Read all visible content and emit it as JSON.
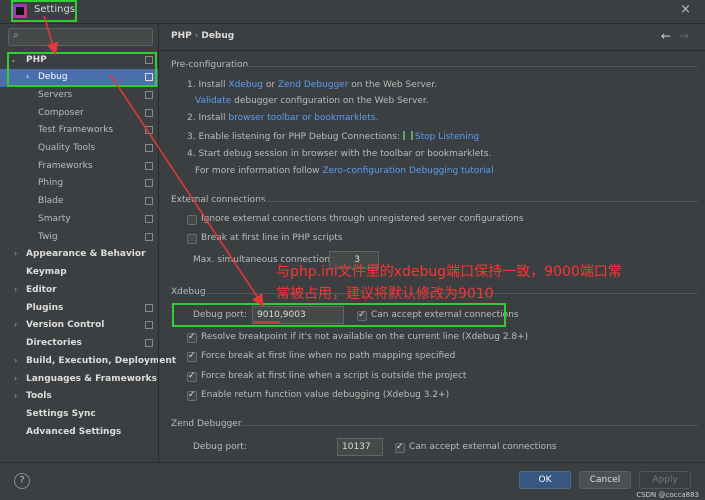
{
  "window": {
    "title": "Settings",
    "close": "×"
  },
  "search": {
    "icon": "search-icon",
    "placeholder": ""
  },
  "sidebar": {
    "php": "PHP",
    "php_children": [
      "Debug",
      "Servers",
      "Composer",
      "Test Frameworks",
      "Quality Tools",
      "Frameworks",
      "Phing",
      "Blade",
      "Smarty",
      "Twig"
    ],
    "groups": [
      "Appearance & Behavior",
      "Keymap",
      "Editor",
      "Plugins",
      "Version Control",
      "Directories",
      "Build, Execution, Deployment",
      "Languages & Frameworks",
      "Tools",
      "Settings Sync",
      "Advanced Settings"
    ]
  },
  "breadcrumb": {
    "parent": "PHP",
    "sep": "›",
    "current": "Debug",
    "back": "←",
    "forward": "→"
  },
  "preconfig": {
    "title": "Pre-configuration",
    "step1_prefix": "1. Install ",
    "step1_link1": "Xdebug",
    "step1_or": " or ",
    "step1_link2": "Zend Debugger",
    "step1_suffix": " on the Web Server.",
    "validate_link": "Validate",
    "validate_suffix": " debugger configuration on the Web Server.",
    "step2_prefix": "2. Install ",
    "step2_link": "browser toolbar or bookmarklets.",
    "step3": "3. Enable listening for PHP Debug Connections:",
    "step3_link": "Stop Listening",
    "step4": "4. Start debug session in browser with the toolbar or bookmarklets.",
    "more_prefix": "For more information follow ",
    "more_link": "Zero-configuration Debugging tutorial"
  },
  "external": {
    "title": "External connections",
    "ignore": "Ignore external connections through unregistered server configurations",
    "break_first": "Break at first line in PHP scripts",
    "max_label": "Max. simultaneous connections:",
    "max_value": "3"
  },
  "xdebug": {
    "title": "Xdebug",
    "port_label": "Debug port:",
    "port_value": "9010,9003",
    "accept_external": "Can accept external connections",
    "resolve_bp": "Resolve breakpoint if it's not available on the current line (Xdebug 2.8+)",
    "force_no_mapping": "Force break at first line when no path mapping specified",
    "force_outside": "Force break at first line when a script is outside the project",
    "return_value": "Enable return function value debugging (Xdebug 3.2+)"
  },
  "zend": {
    "title": "Zend Debugger",
    "port_label": "Debug port:",
    "port_value": "10137",
    "accept_external": "Can accept external connections"
  },
  "annotation": {
    "line1": "与php.ini文件里的xdebug端口保持一致，9000端口常",
    "line2": "常被占用，建议将默认修改为9010",
    "color": "#ff3333"
  },
  "footer": {
    "help": "?",
    "ok": "OK",
    "cancel": "Cancel",
    "apply": "Apply",
    "watermark": "CSDN @cocca883"
  },
  "colors": {
    "accent": "#4b6eaf",
    "link": "#589df6",
    "highlight": "#33cc33",
    "annotation_arrow": "#e53935"
  }
}
